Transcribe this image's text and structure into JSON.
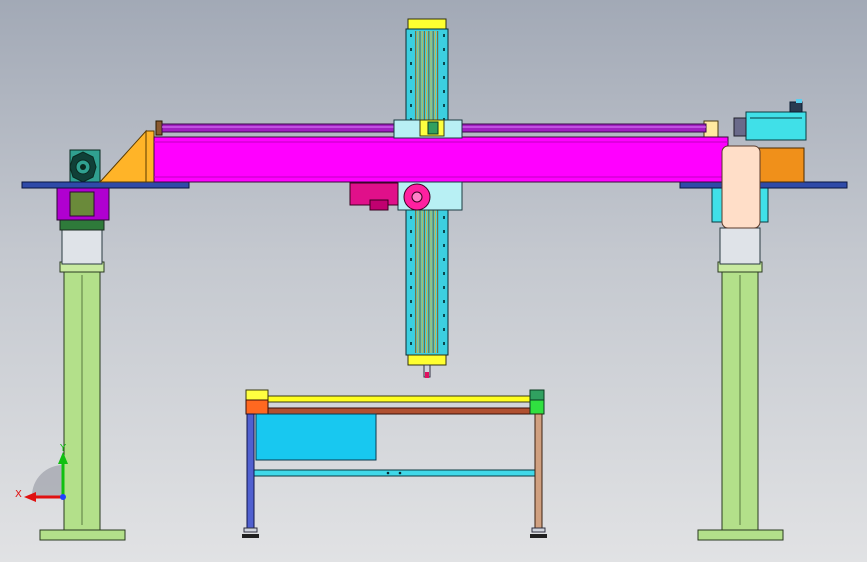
{
  "viewport": {
    "background_top": "#a2a9b6",
    "background_bottom": "#e1e2e4"
  },
  "model": {
    "colors": {
      "column_green": "#b3e08a",
      "base_plate": "#b3e08a",
      "beam_magenta": "#ff00ff",
      "rod_purple": "#a020c0",
      "plate_blue": "#2f4aa8",
      "gusset_orange": "#ffb428",
      "motor_box_orange": "#f0901a",
      "motor_cyan": "#40e0e8",
      "vertical_rail_cyan": "#3ccfe0",
      "rail_stripe_yellow": "#c8b850",
      "table_cyan_panel": "#18c8f0",
      "table_yellow_rod": "#ffff20",
      "table_brown_bar": "#b05030",
      "left_bracket_purple": "#b000d0",
      "gearmotor_teal": "#30a090",
      "cap_peach": "#ffdec8",
      "carriage_light_cyan": "#b8f0f4",
      "drive_motor_pink": "#e0108a"
    }
  },
  "triad": {
    "x_label": "X",
    "y_label": "Y",
    "x_color": "#e01010",
    "y_color": "#10c010",
    "z_color": "#2040ff"
  }
}
